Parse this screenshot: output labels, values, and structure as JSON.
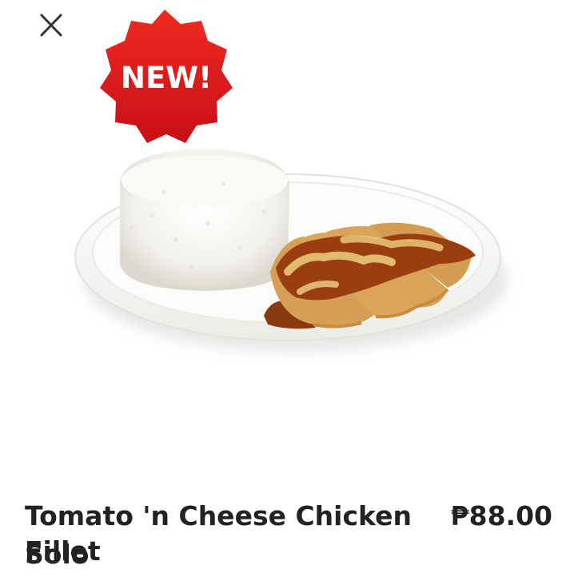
{
  "product": {
    "badge": "NEW!",
    "name": "Tomato 'n Cheese Chicken Fillet",
    "variant": "Solo",
    "price": "₱88.00"
  },
  "icons": {
    "close": "close-icon"
  },
  "colors": {
    "badge_red": "#d7141a",
    "text": "#222222",
    "background": "#ffffff"
  }
}
